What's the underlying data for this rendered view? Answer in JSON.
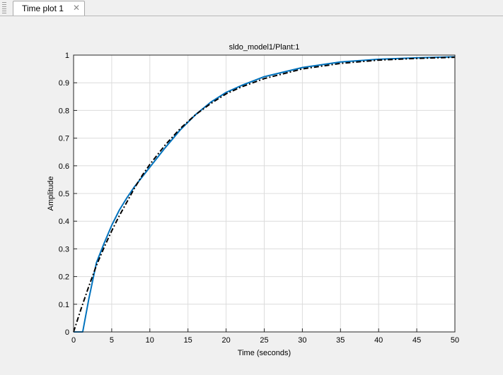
{
  "tabs": [
    {
      "label": "Time plot 1",
      "close_icon": "close-icon"
    }
  ],
  "chart_data": {
    "type": "line",
    "title": "sldo_model1/Plant:1",
    "xlabel": "Time (seconds)",
    "ylabel": "Amplitude",
    "xlim": [
      0,
      50
    ],
    "ylim": [
      0,
      1
    ],
    "xticks": [
      "0",
      "5",
      "10",
      "15",
      "20",
      "25",
      "30",
      "35",
      "40",
      "45",
      "50"
    ],
    "yticks": [
      "0",
      "0.1",
      "0.2",
      "0.3",
      "0.4",
      "0.5",
      "0.6",
      "0.7",
      "0.8",
      "0.9",
      "1"
    ],
    "grid": true,
    "series": [
      {
        "color": "#0072bd",
        "style": "solid",
        "x": [
          0,
          1.2,
          2,
          3,
          4,
          5,
          6,
          7,
          8,
          9,
          10,
          12,
          14,
          16,
          18,
          20,
          22,
          25,
          30,
          35,
          40,
          45,
          50
        ],
        "y": [
          0,
          0,
          0.12,
          0.25,
          0.32,
          0.385,
          0.44,
          0.485,
          0.525,
          0.56,
          0.595,
          0.665,
          0.73,
          0.785,
          0.83,
          0.865,
          0.89,
          0.922,
          0.955,
          0.975,
          0.985,
          0.99,
          0.994
        ]
      },
      {
        "color": "#000000",
        "style": "dashdot",
        "x": [
          0,
          1,
          2,
          3,
          4,
          5,
          6,
          7,
          8,
          9,
          10,
          12,
          14,
          16,
          18,
          20,
          22,
          25,
          30,
          35,
          40,
          45,
          50
        ],
        "y": [
          0,
          0.085,
          0.165,
          0.24,
          0.305,
          0.365,
          0.42,
          0.47,
          0.52,
          0.565,
          0.605,
          0.675,
          0.735,
          0.785,
          0.825,
          0.86,
          0.885,
          0.915,
          0.95,
          0.97,
          0.982,
          0.988,
          0.992
        ]
      }
    ]
  }
}
